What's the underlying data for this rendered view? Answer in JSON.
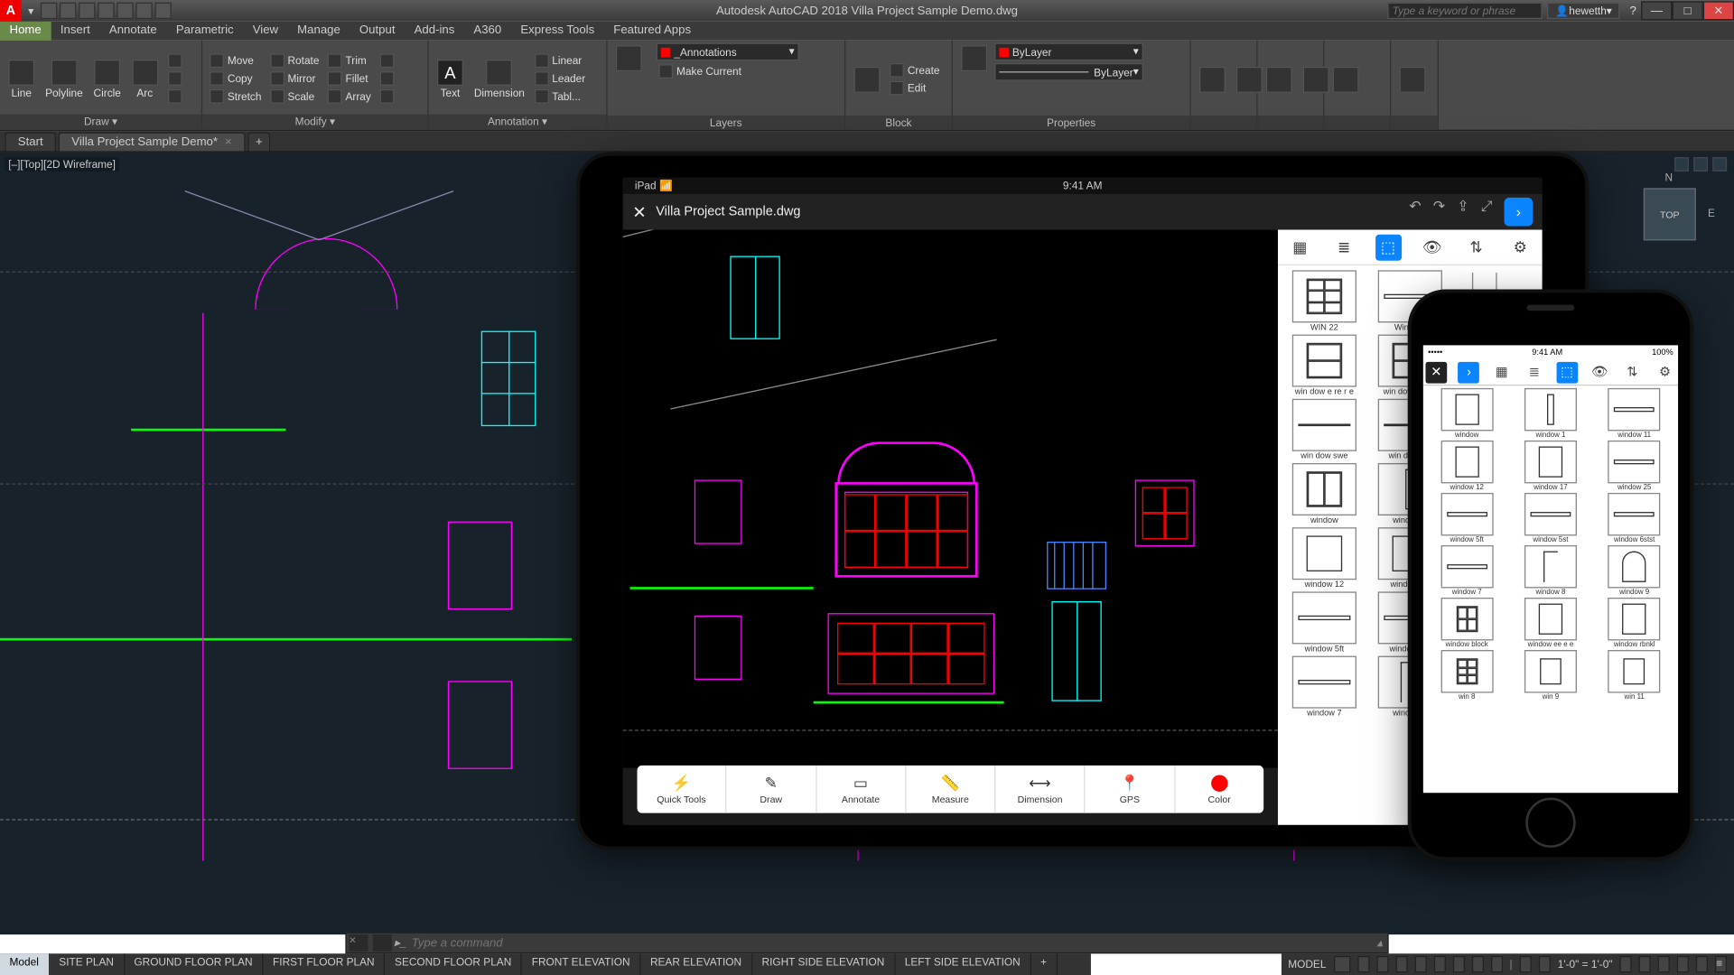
{
  "app": {
    "title": "Autodesk AutoCAD 2018    Villa Project Sample Demo.dwg",
    "logo": "A"
  },
  "search": {
    "placeholder": "Type a keyword or phrase"
  },
  "user": {
    "name": "hewetth"
  },
  "menu": {
    "tabs": [
      "Home",
      "Insert",
      "Annotate",
      "Parametric",
      "View",
      "Manage",
      "Output",
      "Add-ins",
      "A360",
      "Express Tools",
      "Featured Apps"
    ],
    "active": "Home"
  },
  "ribbon": {
    "draw": {
      "label": "Draw ▾",
      "items": [
        "Line",
        "Polyline",
        "Circle",
        "Arc"
      ]
    },
    "modify": {
      "label": "Modify ▾",
      "col1": [
        "Move",
        "Copy",
        "Stretch"
      ],
      "col2": [
        "Rotate",
        "Mirror",
        "Scale"
      ],
      "col3": [
        "Trim",
        "Fillet",
        "Array"
      ]
    },
    "annotation": {
      "label": "Annotation ▾",
      "big": [
        "Text",
        "Dimension"
      ],
      "side": [
        "Linear",
        "Leader",
        "Tabl..."
      ]
    },
    "layers": {
      "label": "Layers",
      "drop": "_Annotations",
      "btns": [
        "Make Current"
      ]
    },
    "block": {
      "label": "Block",
      "btns": [
        "Create",
        "Edit"
      ]
    },
    "properties": {
      "label": "Properties",
      "drop1": "ByLayer",
      "drop2": "ByLayer"
    }
  },
  "fileTabs": {
    "start": "Start",
    "active": "Villa Project Sample Demo*"
  },
  "viewport": {
    "label": "[–][Top][2D Wireframe]"
  },
  "navcube": {
    "face": "TOP",
    "n": "N",
    "e": "E"
  },
  "ipad": {
    "device": "iPad",
    "time": "9:41 AM",
    "file": "Villa Project Sample.dwg",
    "toolbar": [
      "Quick Tools",
      "Draw",
      "Annotate",
      "Measure",
      "Dimension",
      "GPS",
      "Color"
    ],
    "palette": [
      [
        "WIN 22",
        "Win 5FT",
        ""
      ],
      [
        "win dow e re r e",
        "win dow frame",
        ""
      ],
      [
        "win dow swe",
        "win dow wo",
        ""
      ],
      [
        "window",
        "window 1",
        ""
      ],
      [
        "window 12",
        "window 17",
        ""
      ],
      [
        "window 5ft",
        "window 5st",
        ""
      ],
      [
        "window 7",
        "window 8",
        ""
      ]
    ]
  },
  "iphone": {
    "time": "9:41 AM",
    "battery": "100%",
    "palette": [
      [
        "window",
        "window 1",
        "window 11"
      ],
      [
        "window 12",
        "window 17",
        "window 25"
      ],
      [
        "window 5ft",
        "window 5st",
        "window 6stst"
      ],
      [
        "window 7",
        "window 8",
        "window 9"
      ],
      [
        "window block",
        "window ee e e",
        "window rbnkl"
      ],
      [
        "win 8",
        "win 9",
        "win 11"
      ]
    ]
  },
  "commandLine": {
    "placeholder": "Type a command"
  },
  "layoutTabs": [
    "Model",
    "SITE PLAN",
    "GROUND FLOOR PLAN",
    "FIRST FLOOR PLAN",
    "SECOND FLOOR PLAN",
    "FRONT  ELEVATION",
    "REAR  ELEVATION",
    "RIGHT SIDE ELEVATION",
    "LEFT SIDE  ELEVATION",
    "+"
  ],
  "statusBar": {
    "model": "MODEL",
    "scale": "1'-0\" = 1'-0\""
  }
}
